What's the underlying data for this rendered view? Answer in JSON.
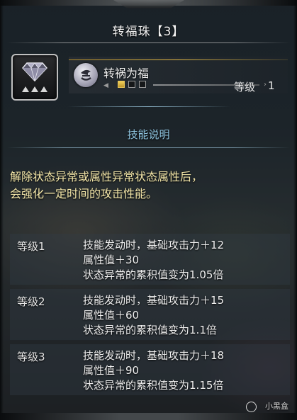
{
  "window": {
    "title": "转福珠【3】"
  },
  "decoration": {
    "icon": "gem-icon"
  },
  "skill": {
    "icon": "skill-icon",
    "name": "转祸为福",
    "level_label": "等级",
    "level_value": "1",
    "pips_filled": 1,
    "pips_total": 3
  },
  "section": {
    "header": "技能说明"
  },
  "description": {
    "line1": "解除状态异常或属性异常状态属性后，",
    "line2": "会强化一定时间的攻击性能。"
  },
  "levels": [
    {
      "name": "等级1",
      "lines": [
        "技能发动时，基础攻击力＋12",
        "属性值＋30",
        "状态异常的累积值变为1.05倍"
      ]
    },
    {
      "name": "等级2",
      "lines": [
        "技能发动时，基础攻击力＋15",
        "属性值＋60",
        "状态异常的累积值变为1.1倍"
      ]
    },
    {
      "name": "等级3",
      "lines": [
        "技能发动时，基础攻击力＋18",
        "属性值＋90",
        "状态异常的累积值变为1.15倍"
      ]
    }
  ],
  "watermark": {
    "text": "小黑盒"
  },
  "colors": {
    "accent_gold": "#e2b944",
    "header_blue": "#8ec4df",
    "description_yellow": "#f3e6a8"
  }
}
